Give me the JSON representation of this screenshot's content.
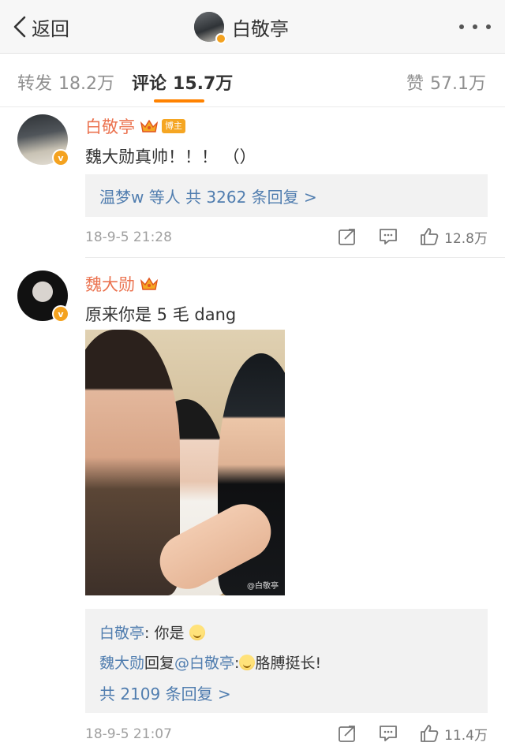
{
  "nav": {
    "back_label": "返回",
    "title": "白敬亭"
  },
  "tabs": {
    "repost": {
      "label": "转发",
      "count": "18.2万"
    },
    "comment": {
      "label": "评论",
      "count": "15.7万"
    },
    "like": {
      "label": "赞",
      "count": "57.1万"
    }
  },
  "comments": [
    {
      "user": "白敬亭",
      "badge": "博主",
      "text": "魏大勋真帅！！！ （）",
      "reply_summary": "温梦w 等人  共 3262 条回复 >",
      "time": "18-9-5 21:28",
      "likes": "12.8万"
    },
    {
      "user": "魏大勋",
      "text": "原来你是 5 毛 dang",
      "photo_watermark": "@白敬亭",
      "replies": [
        {
          "who": "白敬亭",
          "text": ": 你是 "
        },
        {
          "who": "魏大勋",
          "mid": "回复",
          "at": "@白敬亭",
          "text": ":",
          "tail": "胳膊挺长!"
        }
      ],
      "reply_total": "共 2109 条回复 >",
      "time": "18-9-5 21:07",
      "likes": "11.4万"
    }
  ],
  "colors": {
    "accent_orange": "#ff8200",
    "username": "#eb7350",
    "link_blue": "#507daf",
    "verified": "#f4a21f"
  },
  "icons": [
    "chevron-left-icon",
    "more-icon",
    "crown-icon",
    "verified-icon",
    "share-icon",
    "comment-icon",
    "like-icon",
    "smile-emoji-icon"
  ]
}
